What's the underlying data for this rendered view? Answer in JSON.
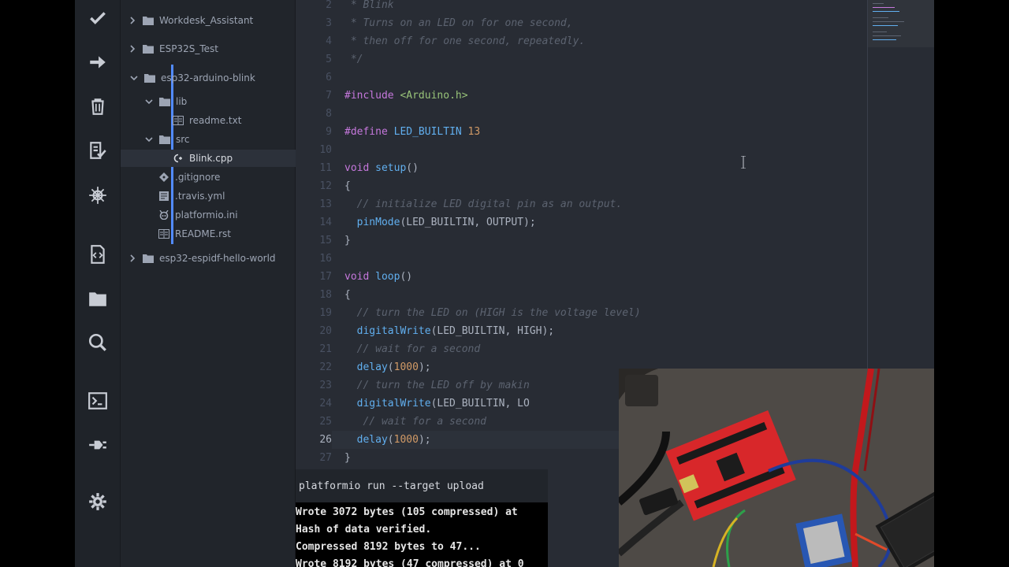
{
  "activity_bar": {
    "icons": [
      "check-icon",
      "arrow-right-icon",
      "trash-icon",
      "checklist-icon",
      "platformio-icon",
      "code-file-icon",
      "folder-icon",
      "search-icon",
      "terminal-icon",
      "plug-icon",
      "gear-icon"
    ]
  },
  "tree": {
    "items": [
      {
        "label": "Workdesk_Assistant"
      },
      {
        "label": "ESP32S_Test"
      },
      {
        "label": "esp32-arduino-blink"
      },
      {
        "label": "lib"
      },
      {
        "label": "readme.txt"
      },
      {
        "label": "src"
      },
      {
        "label": "Blink.cpp"
      },
      {
        "label": ".gitignore"
      },
      {
        "label": ".travis.yml"
      },
      {
        "label": "platformio.ini"
      },
      {
        "label": "README.rst"
      },
      {
        "label": "esp32-espidf-hello-world"
      }
    ]
  },
  "editor": {
    "line_numbers": [
      "2",
      "3",
      "4",
      "5",
      "6",
      "7",
      "8",
      "9",
      "10",
      "11",
      "12",
      "13",
      "14",
      "15",
      "16",
      "17",
      "18",
      "19",
      "20",
      "21",
      "22",
      "23",
      "24",
      "25",
      "26",
      "27"
    ],
    "active_line": "26",
    "code": {
      "l2": " * Blink",
      "l3": " * Turns on an LED on for one second,",
      "l4": " * then off for one second, repeatedly.",
      "l5": " */",
      "l7_kw": "#include",
      "l7_str": "<Arduino.h>",
      "l9_kw": "#define",
      "l9_name": "LED_BUILTIN",
      "l9_num": "13",
      "l11_kw": "void",
      "l11_fn": "setup",
      "l11_rest": "()",
      "l12": "{",
      "l13": "  // initialize LED digital pin as an output.",
      "l14_fn": "pinMode",
      "l14_rest": "(LED_BUILTIN, OUTPUT);",
      "l15": "}",
      "l17_kw": "void",
      "l17_fn": "loop",
      "l17_rest": "()",
      "l18": "{",
      "l19": "  // turn the LED on (HIGH is the voltage level)",
      "l20_fn": "digitalWrite",
      "l20_rest": "(LED_BUILTIN, HIGH);",
      "l21": "  // wait for a second",
      "l22_fn": "delay",
      "l22_open": "(",
      "l22_num": "1000",
      "l22_close": ");",
      "l23": "  // turn the LED off by makin",
      "l24_fn": "digitalWrite",
      "l24_rest": "(LED_BUILTIN, LO",
      "l25": "   // wait for a second",
      "l26_fn": "delay",
      "l26_open": "(",
      "l26_num": "1000",
      "l26_close": ");",
      "l27": "}"
    }
  },
  "terminal": {
    "command": "platformio run --target upload",
    "lines": [
      "Wrote 3072 bytes (105 compressed) at",
      "Hash of data verified.",
      "Compressed 8192 bytes to 47...",
      "Wrote 8192 bytes (47 compressed) at 0"
    ]
  },
  "colors": {
    "accent": "#528bff",
    "background": "#282c34",
    "sidebar": "#21252b",
    "comment": "#5c6370",
    "keyword": "#c678dd",
    "string": "#98c379",
    "number": "#d19a66",
    "function": "#61afef"
  }
}
